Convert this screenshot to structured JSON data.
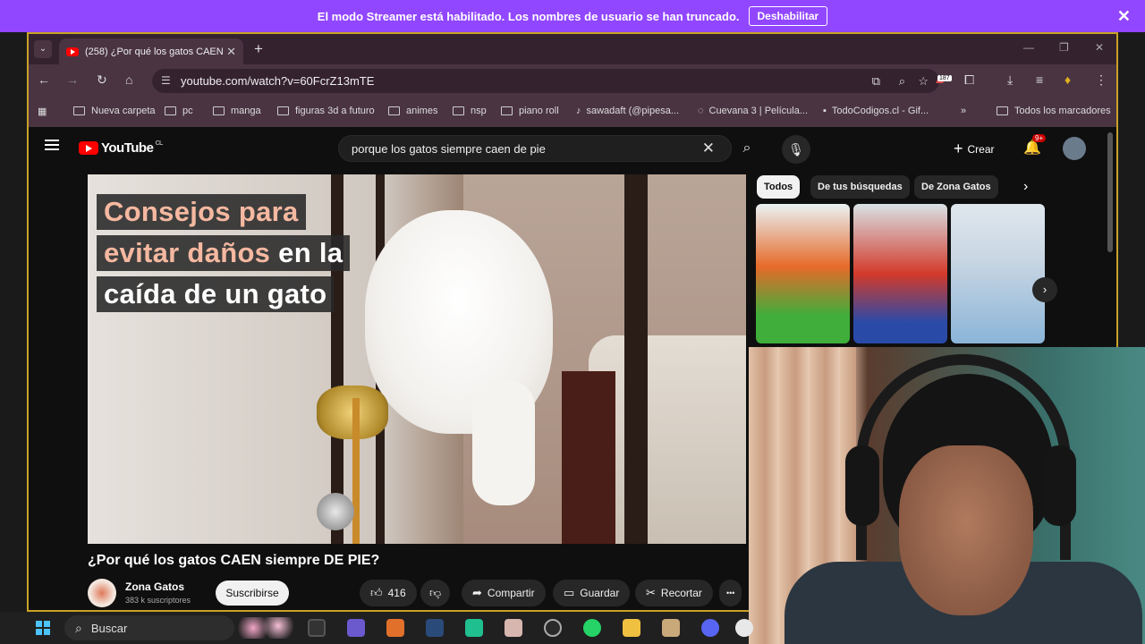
{
  "streamer_bar": {
    "message": "El modo Streamer está habilitado. Los nombres de usuario se han truncado.",
    "button": "Deshabilitar",
    "close": "✕"
  },
  "browser": {
    "tab_title": "(258) ¿Por qué los gatos CAEN",
    "tab_close": "✕",
    "new_tab": "+",
    "url": "youtube.com/watch?v=60FcrZ13mTE",
    "extension_badge": "187",
    "bookmarks": [
      "Nueva carpeta",
      "pc",
      "manga",
      "figuras 3d a futuro",
      "animes",
      "nsp",
      "piano roll",
      "sawadaft (@pipesa...",
      "Cuevana 3 | Película...",
      "TodoCodigos.cl - Gif...",
      "Todos los marcadores"
    ],
    "more_bookmarks": "»"
  },
  "youtube": {
    "logo_text": "YouTube",
    "country_code": "CL",
    "search_query": "porque los gatos siempre caen de pie",
    "create_label": "Crear",
    "notifications": "9+",
    "video": {
      "caption_line1": "Consejos para",
      "caption_line2_orange": "evitar daños",
      "caption_line2_white": " en la",
      "caption_line3": "caída de un gato",
      "title": "¿Por qué los gatos CAEN siempre DE PIE?",
      "channel": "Zona Gatos",
      "subscribers": "383 k suscriptores",
      "subscribe_label": "Suscribirse",
      "likes": "416",
      "share_label": "Compartir",
      "save_label": "Guardar",
      "clip_label": "Recortar",
      "more": "•••"
    },
    "chips": [
      "Todos",
      "De tus búsquedas",
      "De Zona Gatos"
    ]
  },
  "taskbar": {
    "search_placeholder": "Buscar"
  },
  "icons": {
    "close": "close-icon",
    "search": "search-icon",
    "mic": "mic-icon",
    "bell": "bell-icon",
    "like": "thumbs-up-icon",
    "dislike": "thumbs-down-icon",
    "share": "share-icon",
    "save": "bookmark-icon",
    "clip": "scissors-icon",
    "more": "more-icon"
  },
  "colors": {
    "streamer_purple": "#9146ff",
    "youtube_red": "#ff0000",
    "frame_border": "#c9a227",
    "browser_bg": "#4a3442"
  }
}
